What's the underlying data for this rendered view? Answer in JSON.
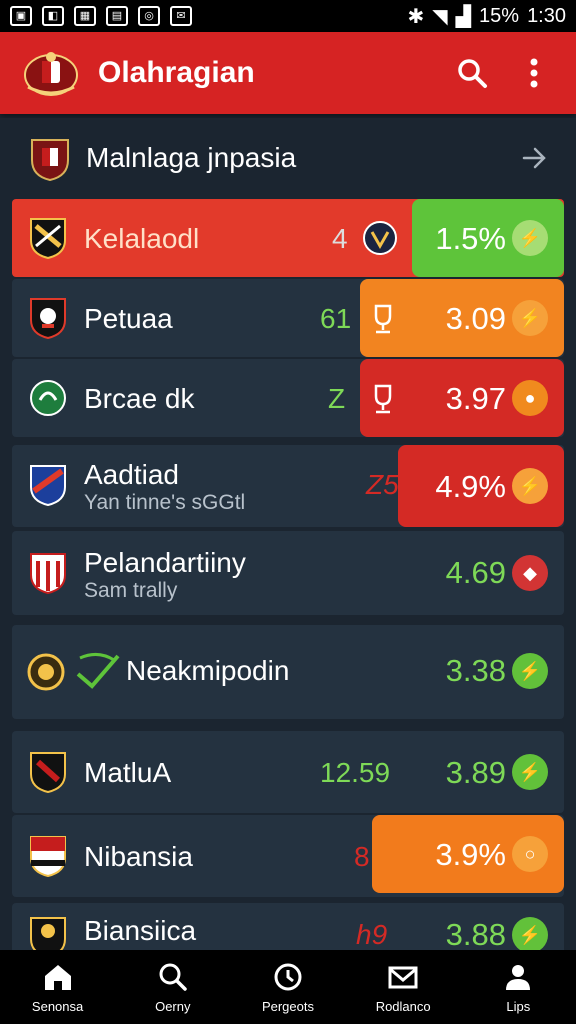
{
  "status_bar": {
    "left_icons": [
      "notification-icon",
      "image-icon",
      "calendar-icon",
      "message-icon",
      "location-icon",
      "mail-icon"
    ],
    "battery": "15%",
    "time": "1:30"
  },
  "app_bar": {
    "title": "Olahragian",
    "search_icon": "search-icon",
    "more_icon": "more-vert-icon"
  },
  "section": {
    "title": "Malnlaga jnpasia",
    "arrow_icon": "arrow-right-icon"
  },
  "rows": [
    {
      "name": "Kelalaodl",
      "sub": "",
      "score": "4",
      "odd": "1.5%",
      "badge_color": "#8bd04a"
    },
    {
      "name": "Petuaa",
      "sub": "",
      "score": "61",
      "odd": "3.09",
      "badge_color": "#f08a1e"
    },
    {
      "name": "Brcae dk",
      "sub": "",
      "score": "Z",
      "odd": "3.97",
      "badge_color": "#f08a1e"
    },
    {
      "name": "Aadtiad",
      "sub": "Yan tinne's sGGtl",
      "score": "Z5",
      "odd": "4.9%",
      "badge_color": "#f08a1e"
    },
    {
      "name": "Pelandartiiny",
      "sub": "Sam trally",
      "score": "",
      "odd": "4.69",
      "badge_color": "#d23434"
    },
    {
      "name": "Neakmipodin",
      "sub": "",
      "score": "",
      "odd": "3.38",
      "badge_color": "#62c13a"
    },
    {
      "name": "MatluA",
      "sub": "",
      "score": "12.59",
      "odd": "3.89",
      "badge_color": "#62c13a"
    },
    {
      "name": "Nibansia",
      "sub": "",
      "score": "8",
      "odd": "3.9%",
      "badge_color": "#f08a1e"
    },
    {
      "name": "Biansiica",
      "sub": "",
      "score": "h9",
      "odd": "3.88",
      "badge_color": "#62c13a"
    }
  ],
  "bottom_nav": [
    {
      "label": "Senonsa",
      "icon": "home-icon"
    },
    {
      "label": "Oerny",
      "icon": "search-icon"
    },
    {
      "label": "Pergeots",
      "icon": "clock-icon"
    },
    {
      "label": "Rodlanco",
      "icon": "mail-icon"
    },
    {
      "label": "Lips",
      "icon": "profile-icon"
    }
  ]
}
